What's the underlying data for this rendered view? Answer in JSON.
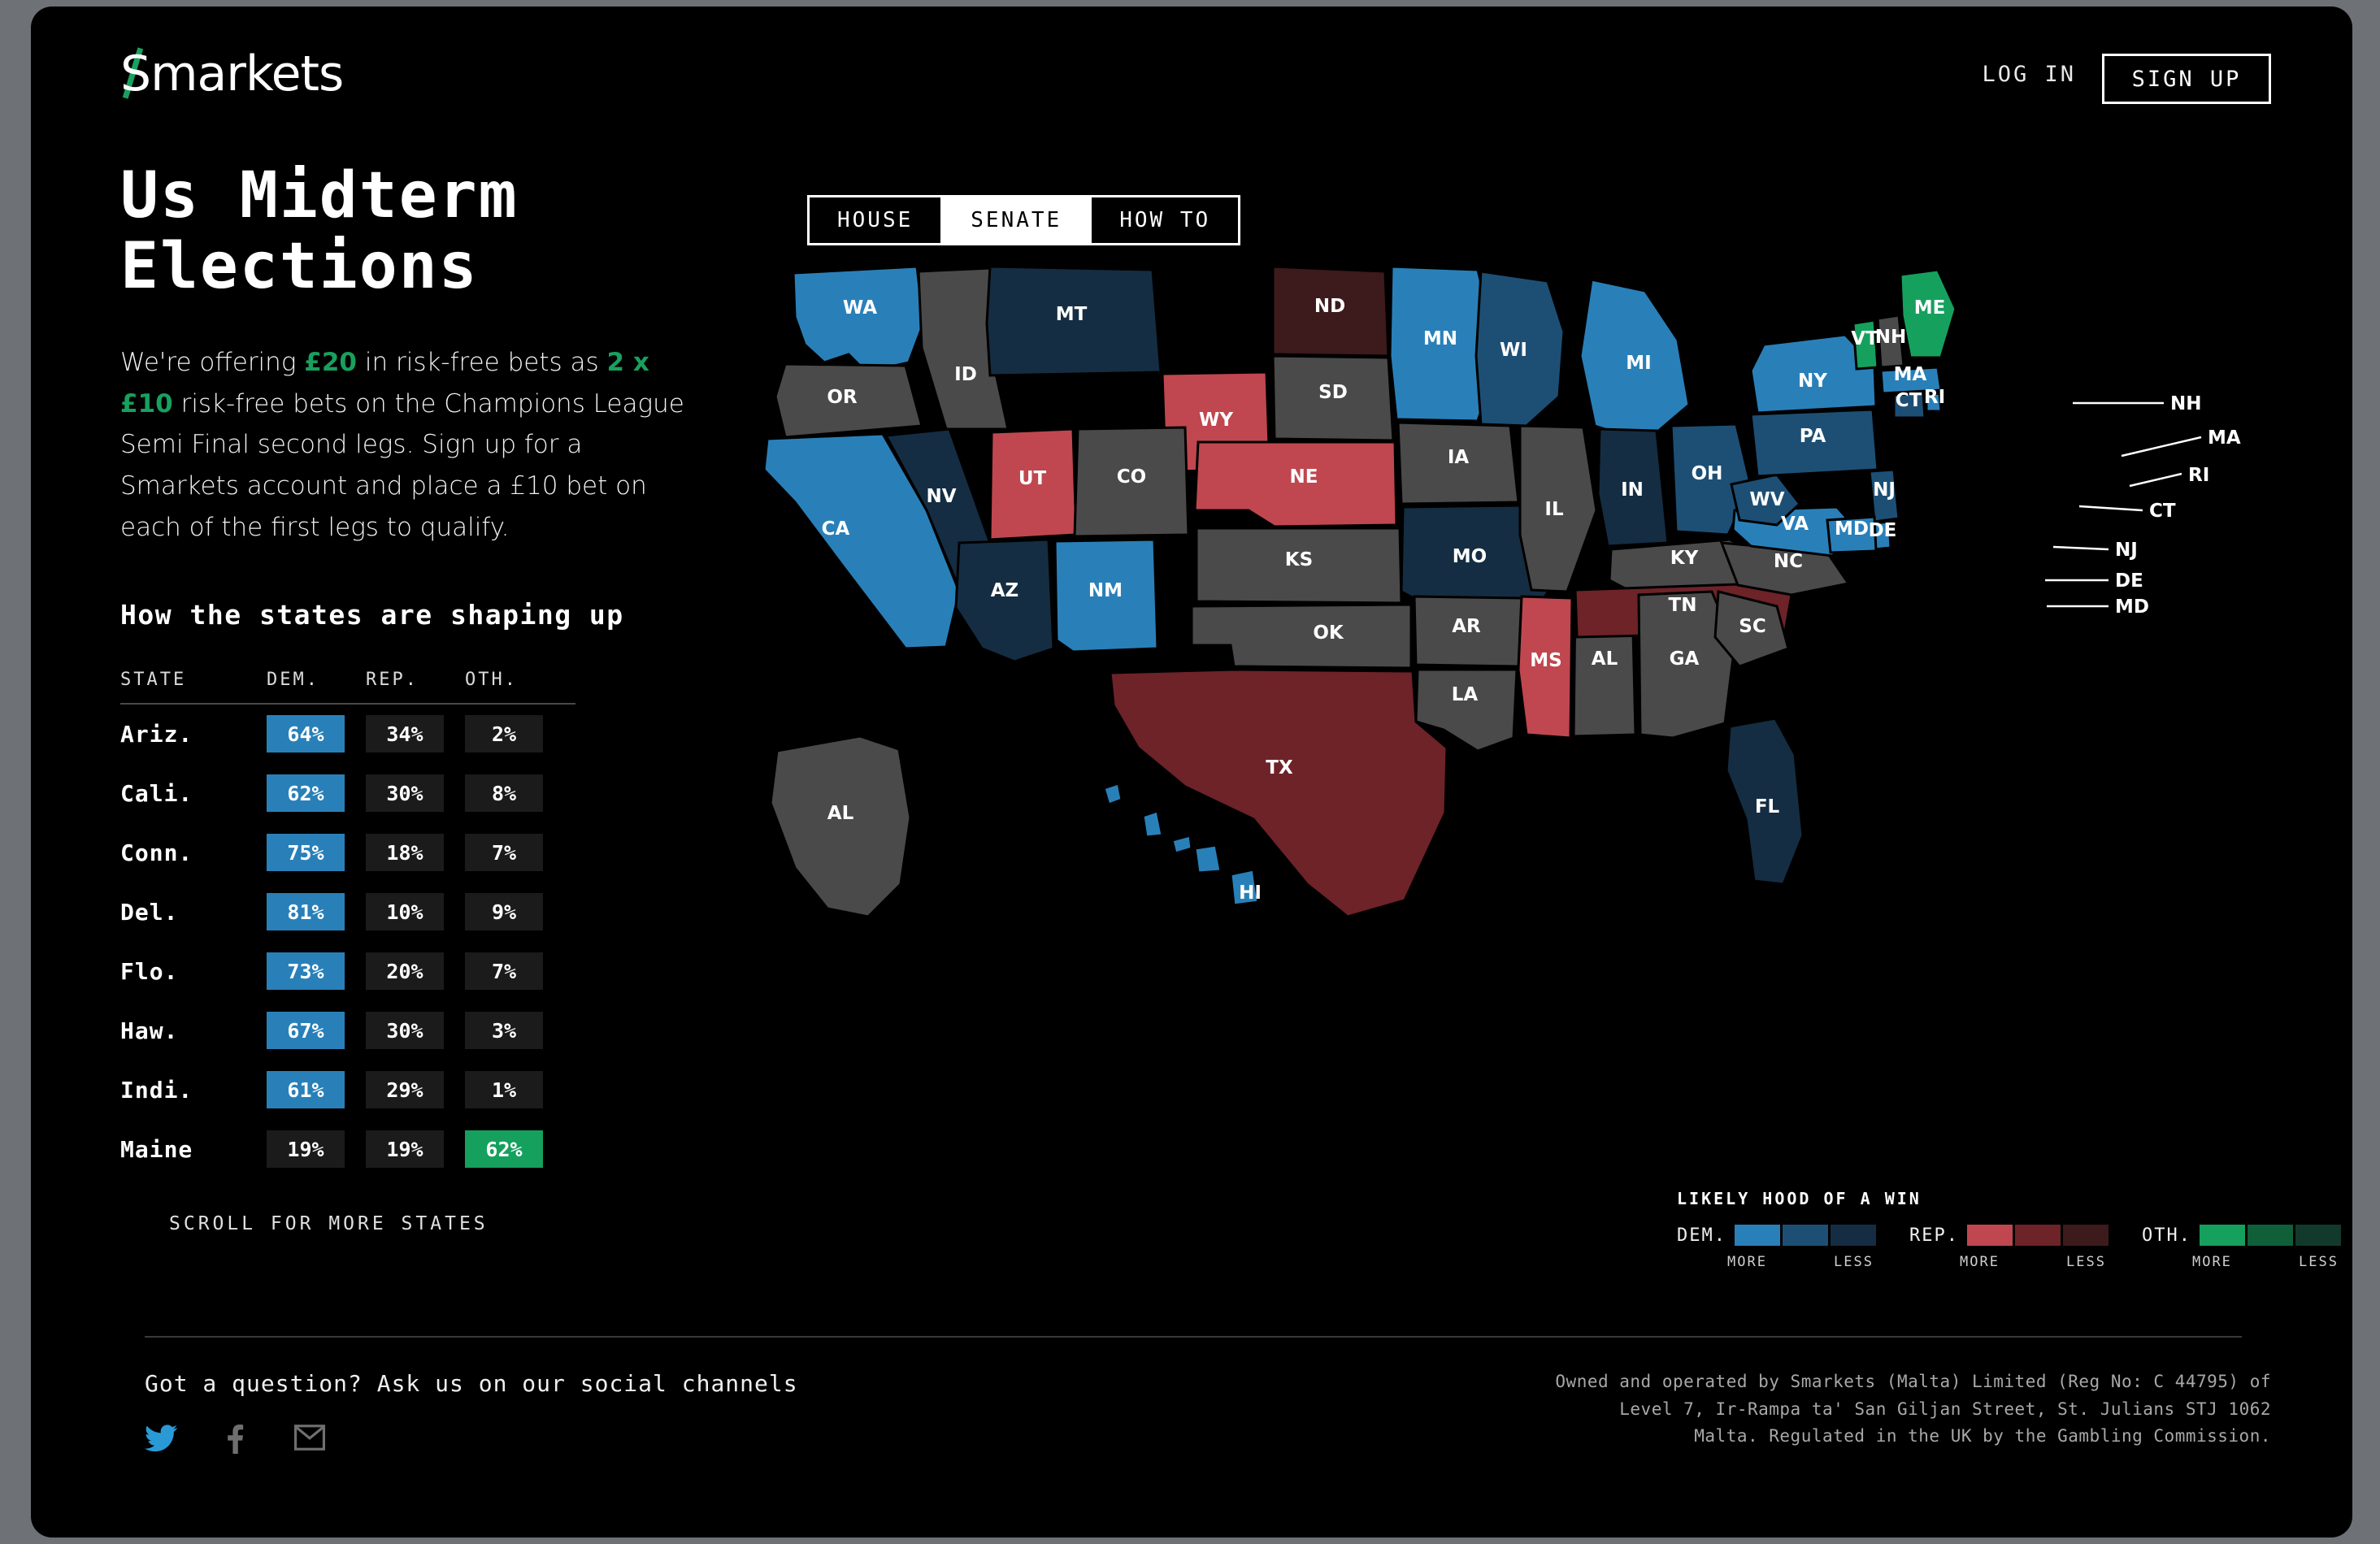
{
  "header": {
    "logo_text": "markets",
    "logo_initial": "S",
    "login_label": "LOG IN",
    "signup_label": "SIGN UP"
  },
  "hero": {
    "title": "Us Midterm\nElections",
    "intro_1": "We're offering ",
    "intro_hl_1": "£20",
    "intro_2": " in risk-free bets as ",
    "intro_hl_2": "2 x £10",
    "intro_3": " risk-free bets on the Champions League Semi Final second legs. Sign up for a Smarkets account and place a £10 bet on each of the first legs to qualify.",
    "subtitle": "How the states are shaping up"
  },
  "table": {
    "columns": [
      "STATE",
      "DEM.",
      "REP.",
      "OTH."
    ],
    "scroll_hint": "SCROLL FOR MORE STATES",
    "rows": [
      {
        "state": "Ariz.",
        "dem": "64%",
        "rep": "34%",
        "oth": "2%",
        "leader": "dem"
      },
      {
        "state": "Cali.",
        "dem": "62%",
        "rep": "30%",
        "oth": "8%",
        "leader": "dem"
      },
      {
        "state": "Conn.",
        "dem": "75%",
        "rep": "18%",
        "oth": "7%",
        "leader": "dem"
      },
      {
        "state": "Del.",
        "dem": "81%",
        "rep": "10%",
        "oth": "9%",
        "leader": "dem"
      },
      {
        "state": "Flo.",
        "dem": "73%",
        "rep": "20%",
        "oth": "7%",
        "leader": "dem"
      },
      {
        "state": "Haw.",
        "dem": "67%",
        "rep": "30%",
        "oth": "3%",
        "leader": "dem"
      },
      {
        "state": "Indi.",
        "dem": "61%",
        "rep": "29%",
        "oth": "1%",
        "leader": "dem"
      },
      {
        "state": "Maine",
        "dem": "19%",
        "rep": "19%",
        "oth": "62%",
        "leader": "oth"
      }
    ]
  },
  "tabs": [
    {
      "label": "HOUSE",
      "active": false
    },
    {
      "label": "SENATE",
      "active": true
    },
    {
      "label": "HOW TO",
      "active": false
    }
  ],
  "legend": {
    "title": "LIKELY HOOD OF A WIN",
    "more_label": "MORE",
    "less_label": "LESS",
    "groups": [
      {
        "label": "DEM.",
        "colors": [
          "#2980b9",
          "#1d4f75",
          "#152d42"
        ]
      },
      {
        "label": "REP.",
        "colors": [
          "#c0474f",
          "#6d2328",
          "#3d1a1c"
        ]
      },
      {
        "label": "OTH.",
        "colors": [
          "#16a05e",
          "#0f5f39",
          "#123a2c"
        ]
      }
    ]
  },
  "footer": {
    "question": "Got a question? Ask us on our social channels",
    "social_icons": [
      "twitter-icon",
      "facebook-icon",
      "email-icon"
    ],
    "legal_line_1": "Owned and operated by Smarkets (Malta) Limited (Reg No: C 44795) of",
    "legal_line_2": "Level 7, Ir-Rampa ta' San Giljan Street, St. Julians STJ 1062",
    "legal_line_3": "Malta. Regulated in the UK by the Gambling Commission."
  },
  "chart_data": {
    "type": "map",
    "title": "Us Midterm Elections — Senate likelihood of a win by state",
    "legend_position": "bottom-right",
    "color_scale": {
      "dem_more": "#2980b9",
      "dem_mid": "#1d4f75",
      "dem_less": "#152d42",
      "rep_more": "#c0474f",
      "rep_mid": "#6d2328",
      "rep_less": "#3d1a1c",
      "oth_more": "#16a05e",
      "oth_mid": "#0f5f39",
      "oth_less": "#123a2c",
      "no_race": "#4a4a4a"
    },
    "states": [
      {
        "code": "WA",
        "party": "dem",
        "shade": "more"
      },
      {
        "code": "OR",
        "party": "none",
        "shade": "none"
      },
      {
        "code": "ID",
        "party": "none",
        "shade": "none"
      },
      {
        "code": "MT",
        "party": "dem",
        "shade": "less"
      },
      {
        "code": "ND",
        "party": "rep",
        "shade": "less"
      },
      {
        "code": "MN",
        "party": "dem",
        "shade": "more"
      },
      {
        "code": "WI",
        "party": "dem",
        "shade": "mid"
      },
      {
        "code": "MI",
        "party": "dem",
        "shade": "more"
      },
      {
        "code": "SD",
        "party": "none",
        "shade": "none"
      },
      {
        "code": "WY",
        "party": "rep",
        "shade": "more"
      },
      {
        "code": "NV",
        "party": "dem",
        "shade": "less"
      },
      {
        "code": "CA",
        "party": "dem",
        "shade": "more"
      },
      {
        "code": "UT",
        "party": "rep",
        "shade": "more"
      },
      {
        "code": "CO",
        "party": "none",
        "shade": "none"
      },
      {
        "code": "NE",
        "party": "rep",
        "shade": "more"
      },
      {
        "code": "IA",
        "party": "none",
        "shade": "none"
      },
      {
        "code": "IL",
        "party": "none",
        "shade": "none"
      },
      {
        "code": "IN",
        "party": "dem",
        "shade": "less"
      },
      {
        "code": "OH",
        "party": "dem",
        "shade": "mid"
      },
      {
        "code": "PA",
        "party": "dem",
        "shade": "mid"
      },
      {
        "code": "NY",
        "party": "dem",
        "shade": "more"
      },
      {
        "code": "VT",
        "party": "oth",
        "shade": "more"
      },
      {
        "code": "ME",
        "party": "oth",
        "shade": "more"
      },
      {
        "code": "NH",
        "party": "none",
        "shade": "none"
      },
      {
        "code": "MA",
        "party": "dem",
        "shade": "more"
      },
      {
        "code": "RI",
        "party": "dem",
        "shade": "more"
      },
      {
        "code": "CT",
        "party": "dem",
        "shade": "mid"
      },
      {
        "code": "NJ",
        "party": "dem",
        "shade": "mid"
      },
      {
        "code": "DE",
        "party": "dem",
        "shade": "more"
      },
      {
        "code": "MD",
        "party": "dem",
        "shade": "more"
      },
      {
        "code": "WV",
        "party": "dem",
        "shade": "mid"
      },
      {
        "code": "VA",
        "party": "dem",
        "shade": "more"
      },
      {
        "code": "KY",
        "party": "none",
        "shade": "none"
      },
      {
        "code": "MO",
        "party": "dem",
        "shade": "less"
      },
      {
        "code": "KS",
        "party": "none",
        "shade": "none"
      },
      {
        "code": "OK",
        "party": "none",
        "shade": "none"
      },
      {
        "code": "AR",
        "party": "none",
        "shade": "none"
      },
      {
        "code": "TN",
        "party": "rep",
        "shade": "mid"
      },
      {
        "code": "NC",
        "party": "none",
        "shade": "none"
      },
      {
        "code": "SC",
        "party": "none",
        "shade": "none"
      },
      {
        "code": "GA",
        "party": "none",
        "shade": "none"
      },
      {
        "code": "AL",
        "party": "none",
        "shade": "none"
      },
      {
        "code": "MS",
        "party": "rep",
        "shade": "more"
      },
      {
        "code": "LA",
        "party": "none",
        "shade": "none"
      },
      {
        "code": "TX",
        "party": "rep",
        "shade": "mid"
      },
      {
        "code": "NM",
        "party": "dem",
        "shade": "more"
      },
      {
        "code": "AZ",
        "party": "dem",
        "shade": "less"
      },
      {
        "code": "FL",
        "party": "dem",
        "shade": "less"
      },
      {
        "code": "HI",
        "party": "dem",
        "shade": "more"
      },
      {
        "code": "AL-AK",
        "label": "AL",
        "party": "none",
        "shade": "none"
      }
    ]
  }
}
